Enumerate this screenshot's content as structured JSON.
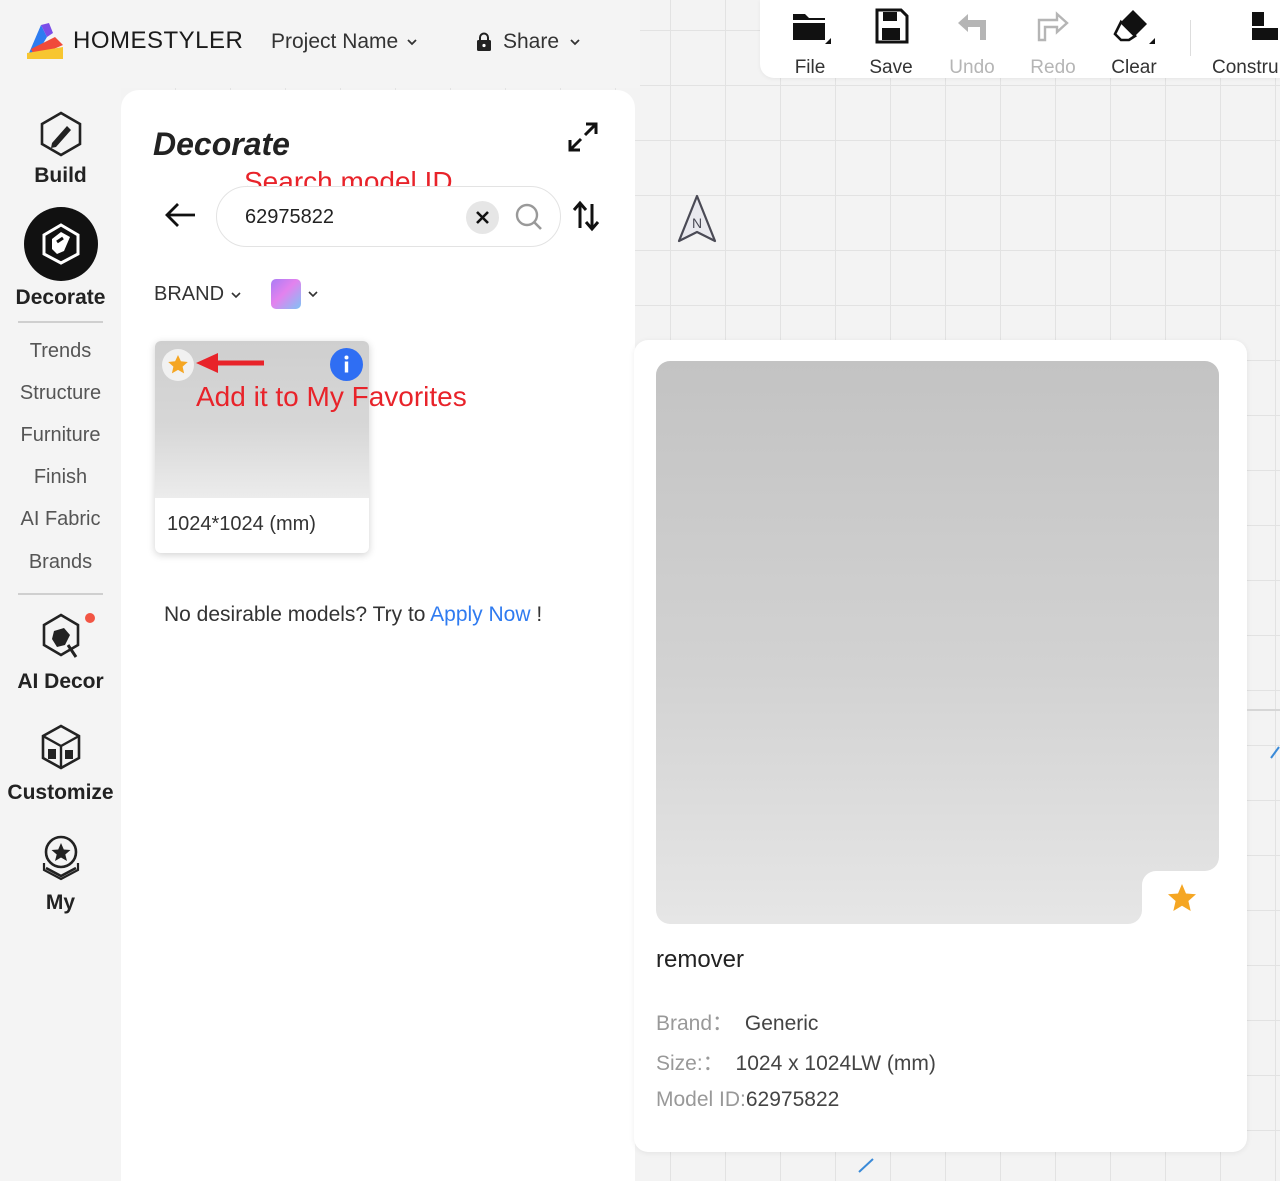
{
  "app": {
    "brand": "HOMESTYLER",
    "project_menu": "Project Name",
    "share_menu": "Share"
  },
  "toolbar": {
    "file": "File",
    "save": "Save",
    "undo": "Undo",
    "redo": "Redo",
    "clear": "Clear",
    "construct": "Constru"
  },
  "nav": {
    "build": "Build",
    "decorate": "Decorate",
    "sub_items": [
      "Trends",
      "Structure",
      "Furniture",
      "Finish",
      "AI Fabric",
      "Brands"
    ],
    "ai_decor": "AI Decor",
    "customize": "Customize",
    "my": "My"
  },
  "panel": {
    "title": "Decorate",
    "search_value": "62975822",
    "filter_brand": "BRAND",
    "result_caption": "1024*1024 (mm)",
    "apply_prefix": "No desirable models? Try to ",
    "apply_link": "Apply Now",
    "apply_suffix": " !"
  },
  "annotations": {
    "search": "Search model ID",
    "favorites": "Add it to My Favorites"
  },
  "compass_label": "N",
  "detail": {
    "name": "remover",
    "brand_label": "Brand：",
    "brand_value": "Generic",
    "size_label": "Size:：",
    "size_value": "1024 x 1024LW (mm)",
    "model_id_label": "Model ID:",
    "model_id_value": "62975822"
  },
  "colors": {
    "accent_blue": "#2f7bf0",
    "annotation_red": "#e8232a",
    "favorite_star": "#f5a623"
  }
}
